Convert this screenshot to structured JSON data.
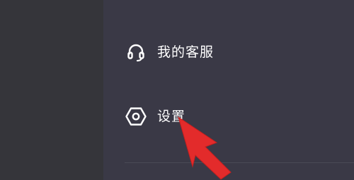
{
  "left_panel": {},
  "drawer": {
    "items": [
      {
        "label": "我的客服",
        "icon": "headset-icon"
      },
      {
        "label": "设置",
        "icon": "hexagon-gear-icon"
      }
    ]
  },
  "overlay": {
    "arrow_color": "#e32b2b",
    "arrow_target": "settings"
  },
  "colors": {
    "drawer_bg": "#3a3946",
    "left_bg": "#35353a",
    "text": "#ffffff"
  }
}
